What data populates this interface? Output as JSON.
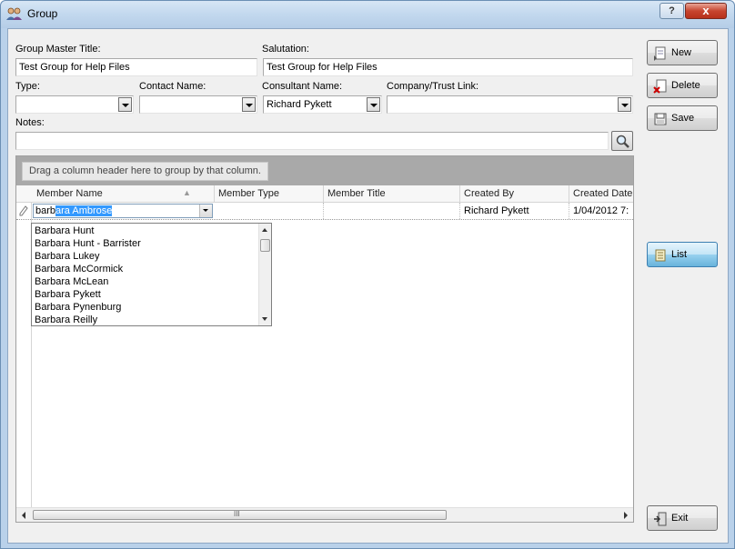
{
  "window": {
    "title": "Group",
    "help_label": "?",
    "close_label": "x"
  },
  "form": {
    "group_master_title_label": "Group Master Title:",
    "group_master_title_value": "Test Group for Help Files",
    "salutation_label": "Salutation:",
    "salutation_value": "Test Group for Help Files",
    "type_label": "Type:",
    "type_value": "",
    "contact_name_label": "Contact Name:",
    "contact_name_value": "",
    "consultant_name_label": "Consultant Name:",
    "consultant_name_value": "Richard Pykett",
    "company_trust_label": "Company/Trust Link:",
    "company_trust_value": "",
    "notes_label": "Notes:",
    "notes_value": ""
  },
  "buttons": {
    "new": "New",
    "delete": "Delete",
    "save": "Save",
    "list": "List",
    "exit": "Exit"
  },
  "grid": {
    "group_hint": "Drag a column header here to group by that column.",
    "columns": [
      "Member Name",
      "Member Type",
      "Member Title",
      "Created By",
      "Created Date"
    ],
    "row": {
      "member_name_typed": "barb",
      "member_name_autocomplete": "ara Ambrose",
      "member_type": "",
      "member_title": "",
      "created_by": "Richard Pykett",
      "created_date": "1/04/2012 7:"
    },
    "scroll_grip": "III"
  },
  "dropdown": {
    "items": [
      "Barbara Hunt",
      "Barbara Hunt - Barrister",
      "Barbara Lukey",
      "Barbara McCormick",
      "Barbara McLean",
      "Barbara Pykett",
      "Barbara Pynenburg",
      "Barbara Reilly"
    ]
  },
  "icons": {
    "app": "group-people-icon",
    "new": "new-document-icon",
    "delete": "delete-icon",
    "save": "save-disk-icon",
    "list": "list-scroll-icon",
    "exit": "exit-door-icon",
    "search": "magnifier-icon",
    "edit_row": "pencil-icon"
  },
  "colors": {
    "window_frame": "#b9d1ea",
    "group_panel": "#a9a9a9",
    "selection": "#3399ff",
    "close_button": "#c7452f"
  }
}
